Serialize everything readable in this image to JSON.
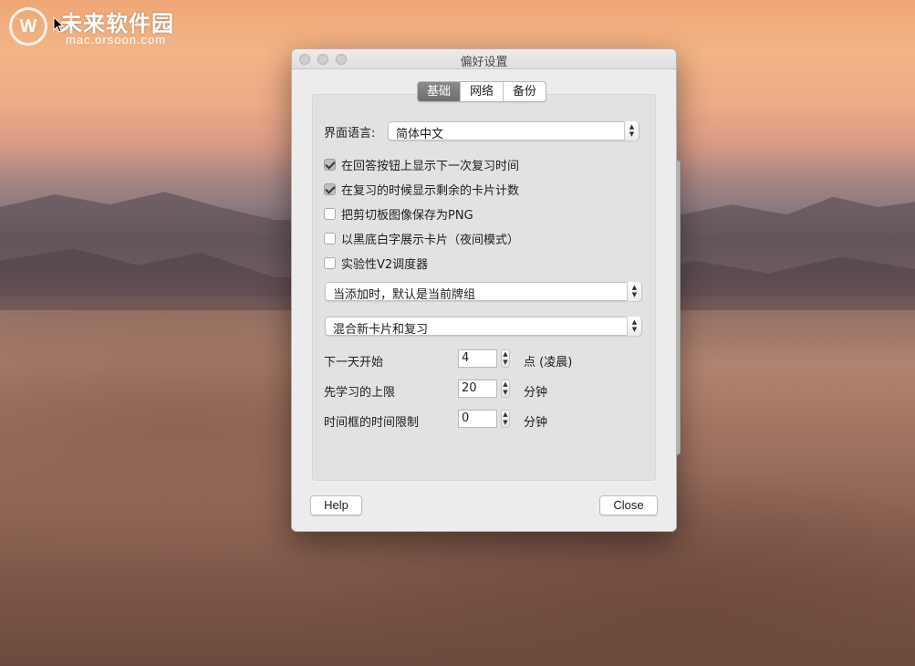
{
  "watermark": {
    "logo": "W",
    "title": "未来软件园",
    "url": "mac.orsoon.com"
  },
  "window": {
    "title": "偏好设置"
  },
  "tabs": [
    {
      "label": "基础",
      "active": true
    },
    {
      "label": "网络",
      "active": false
    },
    {
      "label": "备份",
      "active": false
    }
  ],
  "language": {
    "label": "界面语言:",
    "value": "简体中文"
  },
  "checkboxes": [
    {
      "label": "在回答按钮上显示下一次复习时间",
      "checked": true
    },
    {
      "label": "在复习的时候显示剩余的卡片计数",
      "checked": true
    },
    {
      "label": "把剪切板图像保存为PNG",
      "checked": false
    },
    {
      "label": "以黑底白字展示卡片（夜间模式）",
      "checked": false
    },
    {
      "label": "实验性V2调度器",
      "checked": false
    }
  ],
  "add_default": {
    "value": "当添加时，默认是当前牌组"
  },
  "review_order": {
    "value": "混合新卡片和复习"
  },
  "spinners": [
    {
      "label": "下一天开始",
      "value": "4",
      "unit": "点 (凌晨)"
    },
    {
      "label": "先学习的上限",
      "value": "20",
      "unit": "分钟"
    },
    {
      "label": "时间框的时间限制",
      "value": "0",
      "unit": "分钟"
    }
  ],
  "buttons": {
    "help": "Help",
    "close": "Close"
  },
  "icons": {
    "popup_arrows": "updown-chevron-icon",
    "stepper": "stepper-arrows-icon",
    "cursor": "mouse-pointer-icon"
  }
}
